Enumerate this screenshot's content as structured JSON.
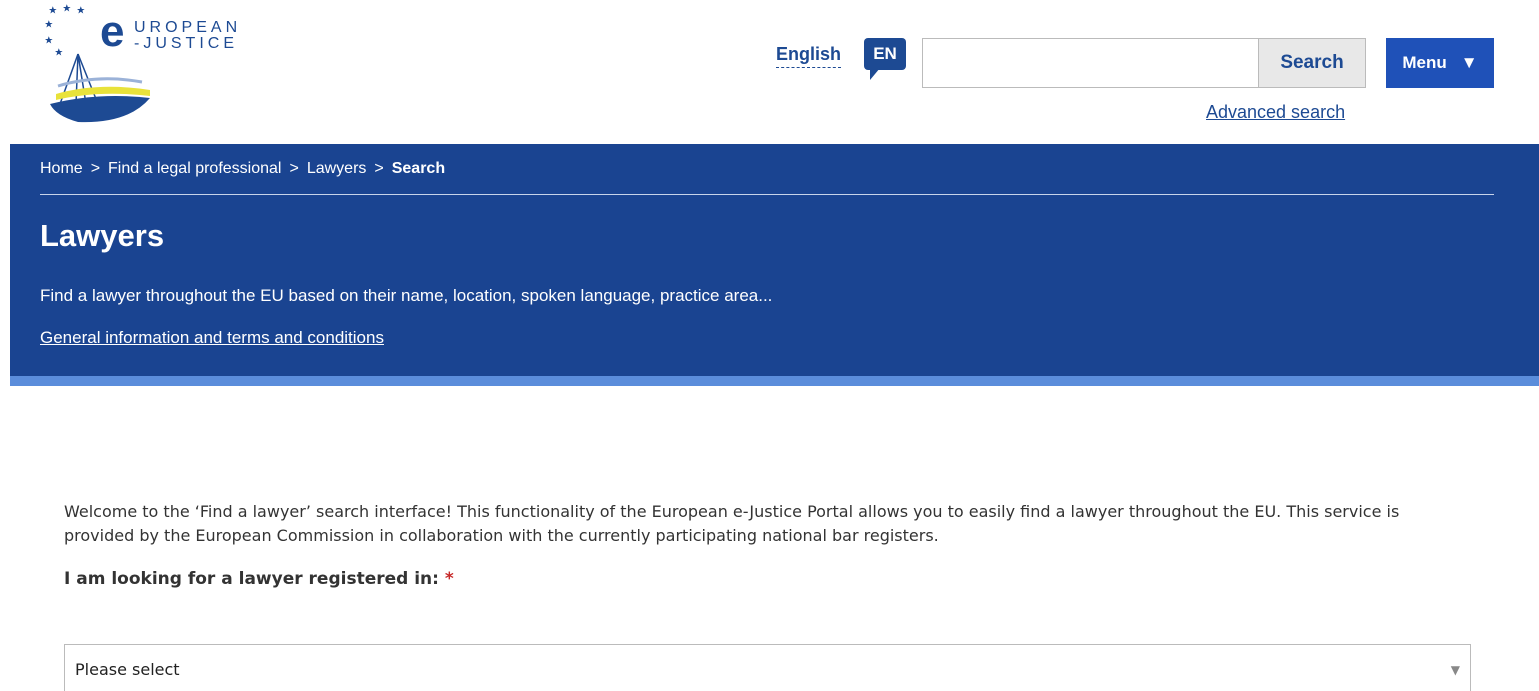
{
  "header": {
    "logo": {
      "letter": "e",
      "line1": "UROPEAN",
      "line2": "-JUSTICE"
    },
    "language": {
      "label": "English",
      "code": "EN"
    },
    "search": {
      "value": "",
      "button_label": "Search",
      "advanced_label": "Advanced search"
    },
    "menu": {
      "label": "Menu",
      "arrow": "▼"
    }
  },
  "breadcrumb": {
    "items": [
      "Home",
      "Find a legal professional",
      "Lawyers",
      "Search"
    ],
    "separator": ">"
  },
  "banner": {
    "title": "Lawyers",
    "subtitle": "Find a lawyer throughout the EU based on their name, location, spoken language, practice area...",
    "terms_link": "General information and terms and conditions"
  },
  "main": {
    "welcome": "Welcome to the ‘Find a lawyer’ search interface! This functionality of the European e-Justice Portal allows you to easily find a lawyer throughout the EU. This service is provided by the European Commission in collaboration with the currently participating national bar registers.",
    "field_label": "I am looking for a lawyer registered in:",
    "required_mark": "*",
    "select_value": "Please select"
  },
  "colors": {
    "brand_blue": "#1a4491",
    "menu_blue": "#1f51b8",
    "stripe_blue": "#5b8ddb",
    "required_red": "#c62828"
  }
}
